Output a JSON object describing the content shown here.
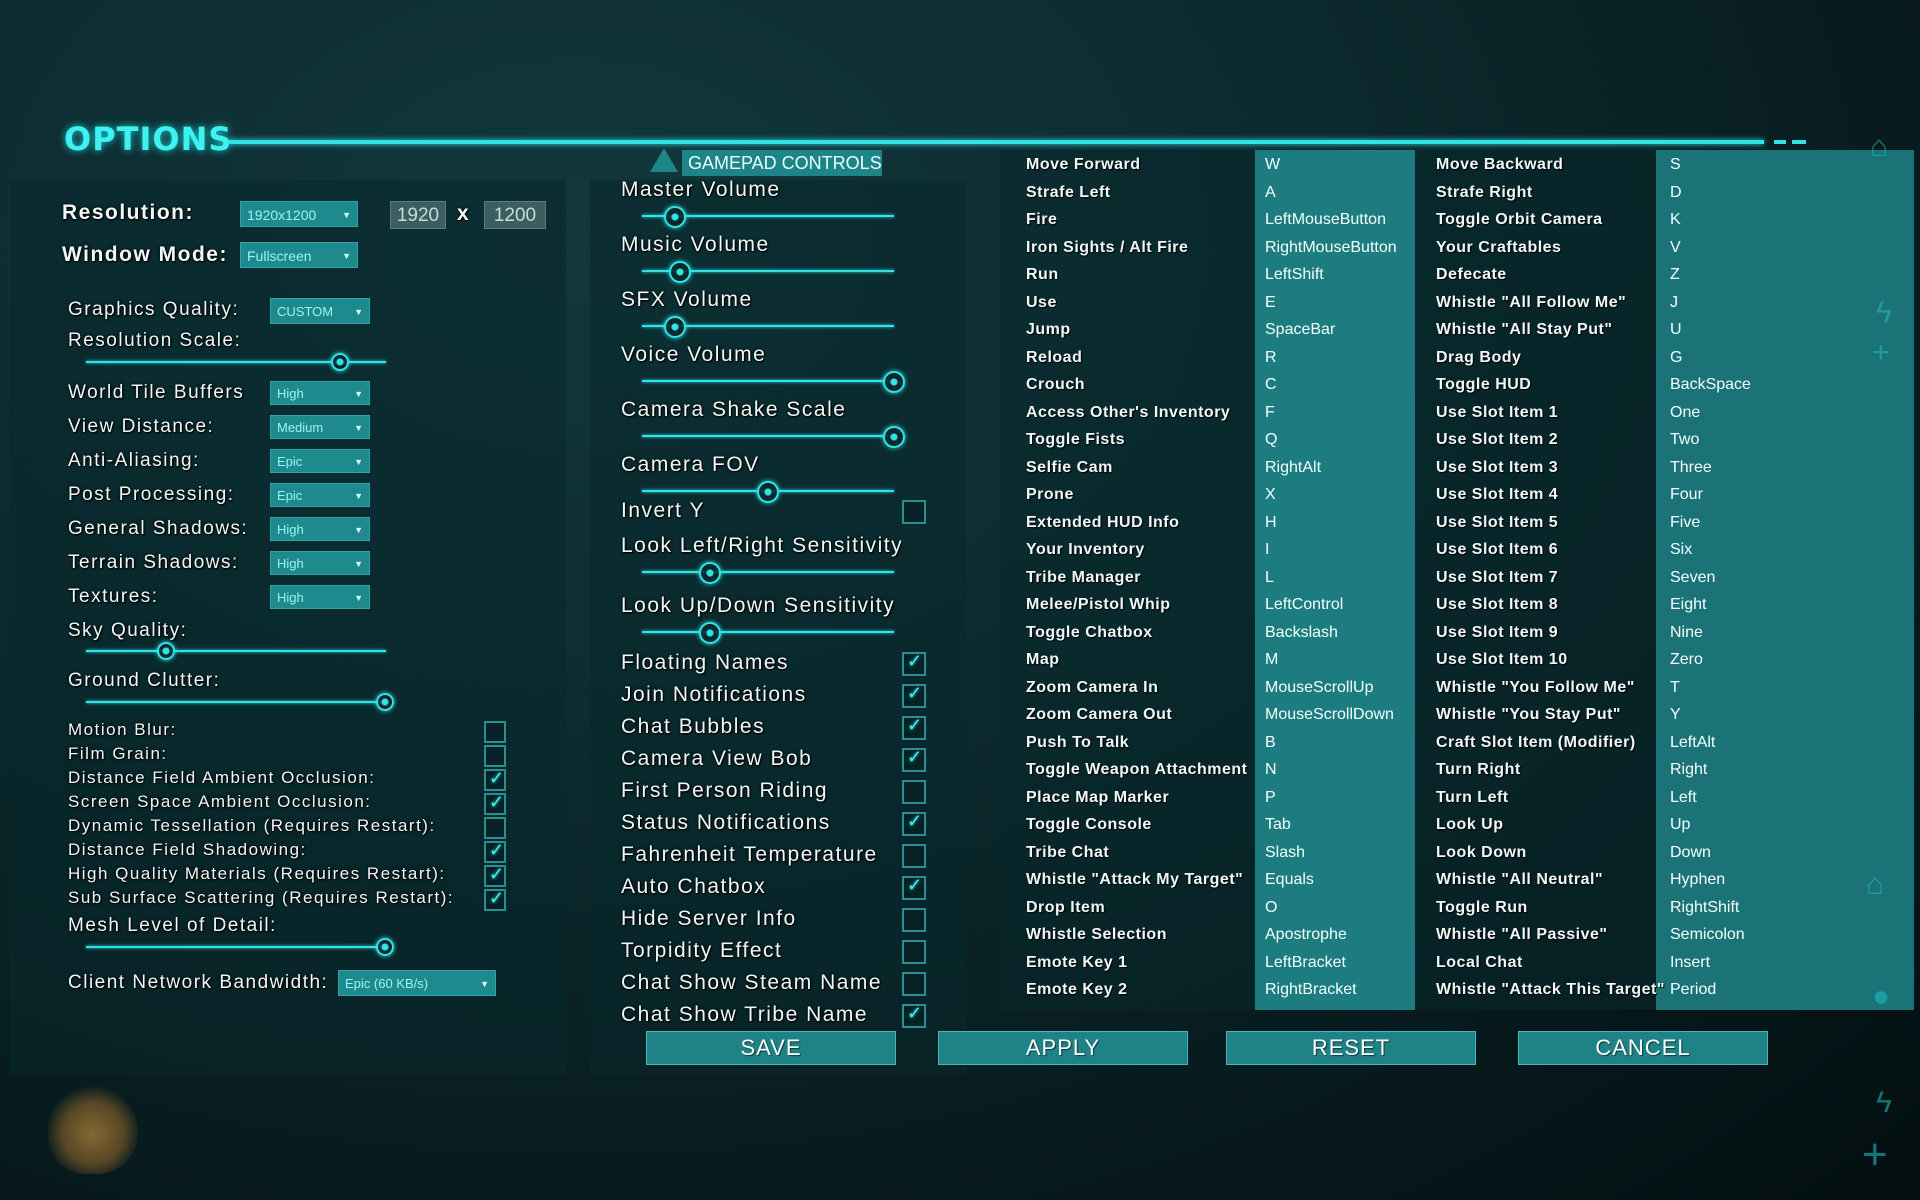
{
  "header": {
    "title": "OPTIONS"
  },
  "graphics": {
    "resolution_label": "Resolution:",
    "resolution_value": "1920x1200",
    "res_width": "1920",
    "res_x": "x",
    "res_height": "1200",
    "window_mode_label": "Window Mode:",
    "window_mode_value": "Fullscreen",
    "quality_label": "Graphics Quality:",
    "quality_value": "CUSTOM",
    "res_scale_label": "Resolution Scale:",
    "res_scale_level": 0.85,
    "settings": [
      {
        "label": "World Tile Buffers",
        "value": "High"
      },
      {
        "label": "View Distance:",
        "value": "Medium"
      },
      {
        "label": "Anti-Aliasing:",
        "value": "Epic"
      },
      {
        "label": "Post Processing:",
        "value": "Epic"
      },
      {
        "label": "General Shadows:",
        "value": "High"
      },
      {
        "label": "Terrain Shadows:",
        "value": "High"
      },
      {
        "label": "Textures:",
        "value": "High"
      }
    ],
    "sky_quality_label": "Sky Quality:",
    "sky_quality_level": 0.27,
    "ground_clutter_label": "Ground Clutter:",
    "ground_clutter_level": 1.0,
    "toggles": [
      {
        "label": "Motion Blur:",
        "checked": false
      },
      {
        "label": "Film Grain:",
        "checked": false
      },
      {
        "label": "Distance Field Ambient Occlusion:",
        "checked": true
      },
      {
        "label": "Screen Space Ambient Occlusion:",
        "checked": true
      },
      {
        "label": "Dynamic Tessellation (Requires Restart):",
        "checked": false
      },
      {
        "label": "Distance Field Shadowing:",
        "checked": true
      },
      {
        "label": "High Quality Materials (Requires Restart):",
        "checked": true
      },
      {
        "label": "Sub Surface Scattering (Requires Restart):",
        "checked": true
      }
    ],
    "mesh_lod_label": "Mesh Level of Detail:",
    "mesh_lod_level": 1.0,
    "bandwidth_label": "Client Network Bandwidth:",
    "bandwidth_value": "Epic (60 KB/s)"
  },
  "audio_gameplay": {
    "gamepad_tab": "GAMEPAD CONTROLS",
    "sliders": [
      {
        "label": "Master Volume",
        "level": 0.13
      },
      {
        "label": "Music Volume",
        "level": 0.15
      },
      {
        "label": "SFX Volume",
        "level": 0.13
      },
      {
        "label": "Voice Volume",
        "level": 1.0
      },
      {
        "label": "Camera Shake Scale",
        "level": 1.0
      },
      {
        "label": "Camera FOV",
        "level": 0.5
      }
    ],
    "invert_y_label": "Invert Y",
    "invert_y_checked": false,
    "sensitivity": [
      {
        "label": "Look Left/Right Sensitivity",
        "level": 0.27
      },
      {
        "label": "Look Up/Down Sensitivity",
        "level": 0.27
      }
    ],
    "checkboxes": [
      {
        "label": "Floating Names",
        "checked": true
      },
      {
        "label": "Join Notifications",
        "checked": true
      },
      {
        "label": "Chat Bubbles",
        "checked": true
      },
      {
        "label": "Camera View Bob",
        "checked": true
      },
      {
        "label": "First Person Riding",
        "checked": false
      },
      {
        "label": "Status Notifications",
        "checked": true
      },
      {
        "label": "Fahrenheit Temperature",
        "checked": false
      },
      {
        "label": "Auto Chatbox",
        "checked": true
      },
      {
        "label": "Hide Server Info",
        "checked": false
      },
      {
        "label": "Torpidity Effect",
        "checked": false
      },
      {
        "label": "Chat Show Steam Name",
        "checked": false
      },
      {
        "label": "Chat Show Tribe Name",
        "checked": true
      }
    ]
  },
  "keybindings": {
    "left": [
      [
        "Move Forward",
        "W"
      ],
      [
        "Strafe Left",
        "A"
      ],
      [
        "Fire",
        "LeftMouseButton"
      ],
      [
        "Iron Sights / Alt Fire",
        "RightMouseButton"
      ],
      [
        "Run",
        "LeftShift"
      ],
      [
        "Use",
        "E"
      ],
      [
        "Jump",
        "SpaceBar"
      ],
      [
        "Reload",
        "R"
      ],
      [
        "Crouch",
        "C"
      ],
      [
        "Access Other's Inventory",
        "F"
      ],
      [
        "Toggle Fists",
        "Q"
      ],
      [
        "Selfie Cam",
        "RightAlt"
      ],
      [
        "Prone",
        "X"
      ],
      [
        "Extended HUD Info",
        "H"
      ],
      [
        "Your Inventory",
        "I"
      ],
      [
        "Tribe Manager",
        "L"
      ],
      [
        "Melee/Pistol Whip",
        "LeftControl"
      ],
      [
        "Toggle Chatbox",
        "Backslash"
      ],
      [
        "Map",
        "M"
      ],
      [
        "Zoom Camera In",
        "MouseScrollUp"
      ],
      [
        "Zoom Camera Out",
        "MouseScrollDown"
      ],
      [
        "Push To Talk",
        "B"
      ],
      [
        "Toggle Weapon Attachment",
        "N"
      ],
      [
        "Place Map Marker",
        "P"
      ],
      [
        "Toggle Console",
        "Tab"
      ],
      [
        "Tribe Chat",
        "Slash"
      ],
      [
        "Whistle \"Attack My Target\"",
        "Equals"
      ],
      [
        "Drop Item",
        "O"
      ],
      [
        "Whistle Selection",
        "Apostrophe"
      ],
      [
        "Emote Key 1",
        "LeftBracket"
      ],
      [
        "Emote Key 2",
        "RightBracket"
      ]
    ],
    "right": [
      [
        "Move Backward",
        "S"
      ],
      [
        "Strafe Right",
        "D"
      ],
      [
        "Toggle Orbit Camera",
        "K"
      ],
      [
        "Your Craftables",
        "V"
      ],
      [
        "Defecate",
        "Z"
      ],
      [
        "Whistle \"All Follow Me\"",
        "J"
      ],
      [
        "Whistle \"All Stay Put\"",
        "U"
      ],
      [
        "Drag Body",
        "G"
      ],
      [
        "Toggle HUD",
        "BackSpace"
      ],
      [
        "Use Slot Item 1",
        "One"
      ],
      [
        "Use Slot Item 2",
        "Two"
      ],
      [
        "Use Slot Item 3",
        "Three"
      ],
      [
        "Use Slot Item 4",
        "Four"
      ],
      [
        "Use Slot Item 5",
        "Five"
      ],
      [
        "Use Slot Item 6",
        "Six"
      ],
      [
        "Use Slot Item 7",
        "Seven"
      ],
      [
        "Use Slot Item 8",
        "Eight"
      ],
      [
        "Use Slot Item 9",
        "Nine"
      ],
      [
        "Use Slot Item 10",
        "Zero"
      ],
      [
        "Whistle \"You Follow Me\"",
        "T"
      ],
      [
        "Whistle \"You Stay Put\"",
        "Y"
      ],
      [
        "Craft Slot Item (Modifier)",
        "LeftAlt"
      ],
      [
        "Turn Right",
        "Right"
      ],
      [
        "Turn Left",
        "Left"
      ],
      [
        "Look Up",
        "Up"
      ],
      [
        "Look Down",
        "Down"
      ],
      [
        "Whistle \"All Neutral\"",
        "Hyphen"
      ],
      [
        "Toggle Run",
        "RightShift"
      ],
      [
        "Whistle \"All Passive\"",
        "Semicolon"
      ],
      [
        "Local Chat",
        "Insert"
      ],
      [
        "Whistle \"Attack This Target\"",
        "Period"
      ]
    ]
  },
  "buttons": {
    "save": "SAVE",
    "apply": "APPLY",
    "reset": "RESET",
    "cancel": "CANCEL"
  },
  "colors": {
    "accent": "#2fe3e6",
    "panel_teal": "#1c7c80",
    "button": "#1f8286"
  }
}
